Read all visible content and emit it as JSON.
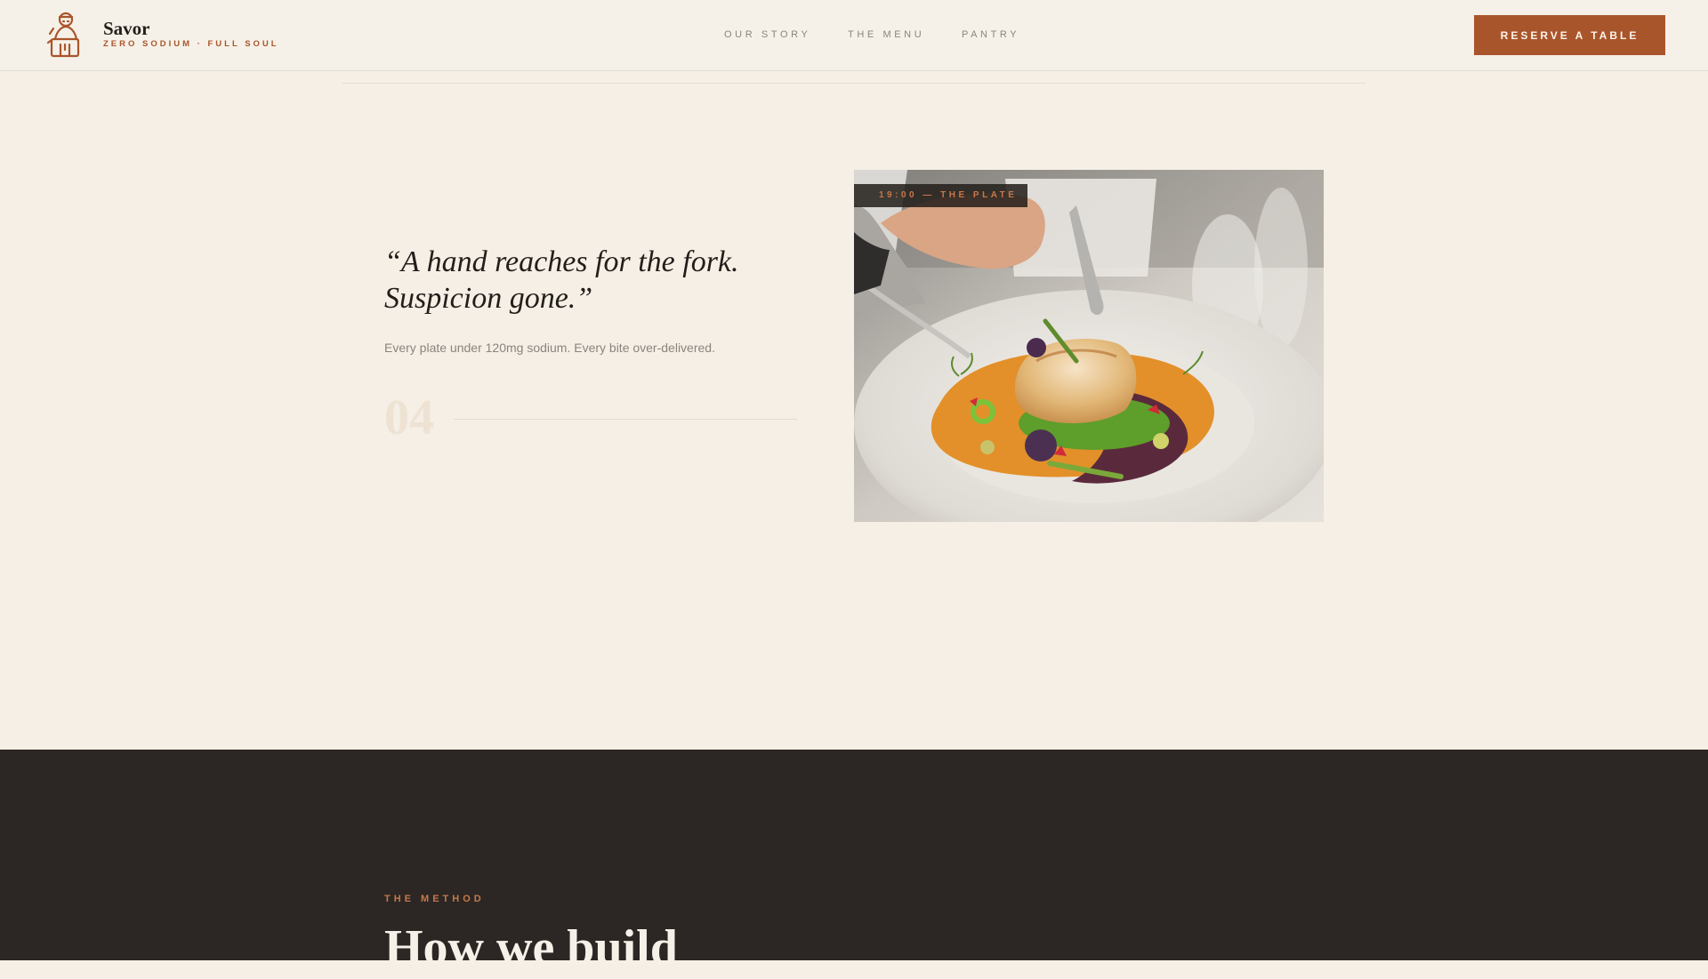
{
  "brand": {
    "name": "Savor",
    "tagline": "ZERO SODIUM · FULL SOUL"
  },
  "nav": {
    "items": [
      {
        "label": "OUR STORY"
      },
      {
        "label": "THE MENU"
      },
      {
        "label": "PANTRY"
      }
    ],
    "cta_label": "RESERVE A TABLE"
  },
  "story": {
    "quote": "“A hand reaches for the fork. Suspicion gone.”",
    "subtext": "Every plate under 120mg sodium. Every bite over-delivered.",
    "step_number": "04",
    "photo_caption": "19:00 — THE PLATE"
  },
  "method": {
    "eyebrow": "THE METHOD",
    "title": "How we build"
  },
  "colors": {
    "accent": "#a9552c",
    "background": "#f5efe6",
    "dark": "#2c2724",
    "ink": "#231e1a"
  }
}
